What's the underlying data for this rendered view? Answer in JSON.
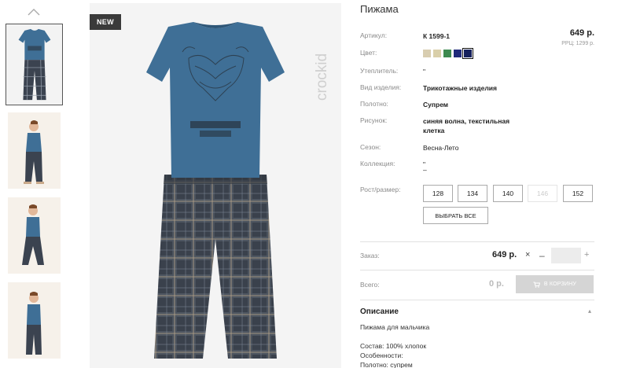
{
  "product": {
    "title": "Пижама",
    "badge": "NEW",
    "brand_logo_text": "crockid",
    "price": "649 р.",
    "rrp": "РРЦ: 1299 р.",
    "colors": [
      "#d8cdb0",
      "#d9cfa9",
      "#3d8a4f",
      "#1f2a7a",
      "#15205c"
    ],
    "selected_color_index": 4
  },
  "attributes": [
    {
      "label": "Артикул:",
      "value": "К 1599-1"
    },
    {
      "label": "Цвет:",
      "value": ""
    },
    {
      "label": "Утеплитель:",
      "value": "\""
    },
    {
      "label": "Вид изделия:",
      "value": "Трикотажные изделия"
    },
    {
      "label": "Полотно:",
      "value": "Супрем"
    },
    {
      "label": "Рисунок:",
      "value": "синяя волна, текстильная клетка"
    },
    {
      "label": "Сезон:",
      "value": "Весна-Лето"
    },
    {
      "label": "Коллекция:",
      "value": "\""
    },
    {
      "label": "Рост/размер:",
      "value": ""
    }
  ],
  "collection_dash": "–",
  "sizes": [
    {
      "label": "128",
      "available": true
    },
    {
      "label": "134",
      "available": true
    },
    {
      "label": "140",
      "available": true
    },
    {
      "label": "146",
      "available": false
    },
    {
      "label": "152",
      "available": true
    }
  ],
  "select_all_label": "ВЫБРАТЬ ВСЕ",
  "order": {
    "label": "Заказ:",
    "price": "649 р.",
    "times": "×",
    "minus": "–",
    "plus": "+",
    "quantity": ""
  },
  "total": {
    "label": "Всего:",
    "value": "0 р.",
    "cart_button": "В КОРЗИНУ"
  },
  "description": {
    "heading": "Описание",
    "toggle": "▴",
    "lines": [
      "Пижама для мальчика",
      "",
      "Состав: 100% хлопок",
      "Особенности:",
      "Полотно: супрем"
    ]
  },
  "icons": {
    "thumb_scroll_up": "chevron-up-icon",
    "cart": "cart-icon"
  }
}
